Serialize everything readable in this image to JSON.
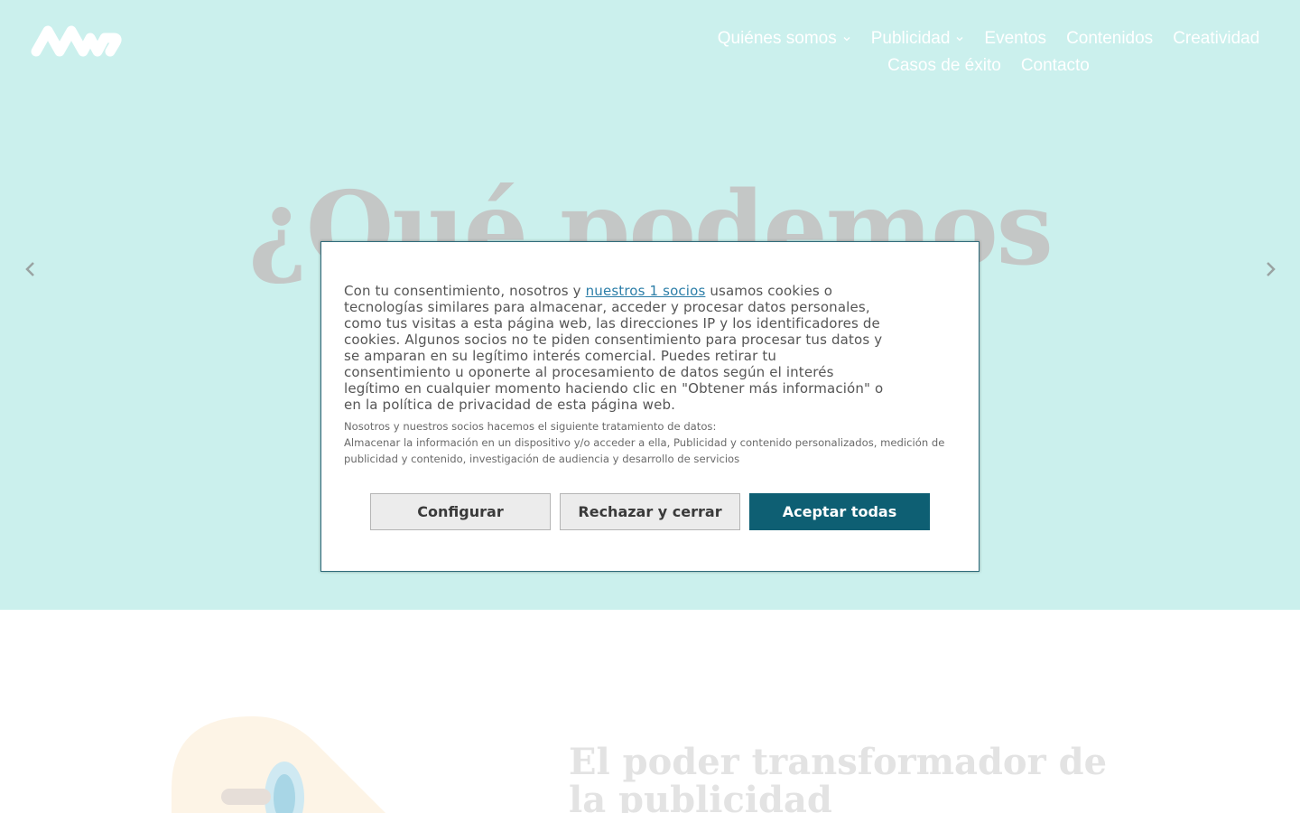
{
  "header": {
    "logo_icon": "aiv-wave-logo",
    "nav_row1": [
      {
        "label": "Quiénes somos",
        "has_dropdown": true
      },
      {
        "label": "Publicidad",
        "has_dropdown": true
      },
      {
        "label": "Eventos",
        "has_dropdown": false
      },
      {
        "label": "Contenidos",
        "has_dropdown": false
      },
      {
        "label": "Creatividad",
        "has_dropdown": false
      }
    ],
    "nav_row2": [
      {
        "label": "Casos de éxito"
      },
      {
        "label": "Contacto"
      }
    ]
  },
  "hero": {
    "title": "¿Qué podemos",
    "background_color": "#cbf0ed",
    "prev_icon": "chevron-left-icon",
    "next_icon": "chevron-right-icon"
  },
  "section2": {
    "title": "El poder transformador de la publicidad",
    "illustration_icon": "megaphone-illustration"
  },
  "cookie_dialog": {
    "text_before_link": "Con tu consentimiento, nosotros y ",
    "partners_link": "nuestros 1 socios",
    "text_after_link": " usamos cookies o tecnologías similares para almacenar, acceder y procesar datos personales, como tus visitas a esta página web, las direcciones IP y los identificadores de cookies. Algunos socios no te piden consentimiento para procesar tus datos y se amparan en su legítimo interés comercial. Puedes retirar tu consentimiento u oponerte al procesamiento de datos según el interés legítimo en cualquier momento haciendo clic en \"Obtener más información\" o en la política de privacidad de esta página web.",
    "processing_heading": "Nosotros y nuestros socios hacemos el siguiente tratamiento de datos:",
    "processing_list": "Almacenar la información en un dispositivo y/o acceder a ella, Publicidad y contenido personalizados, medición de publicidad y contenido, investigación de audiencia y desarrollo de servicios",
    "buttons": {
      "configure": "Configurar",
      "reject": "Rechazar y cerrar",
      "accept": "Aceptar todas"
    },
    "accent_color": "#0e5f73"
  }
}
